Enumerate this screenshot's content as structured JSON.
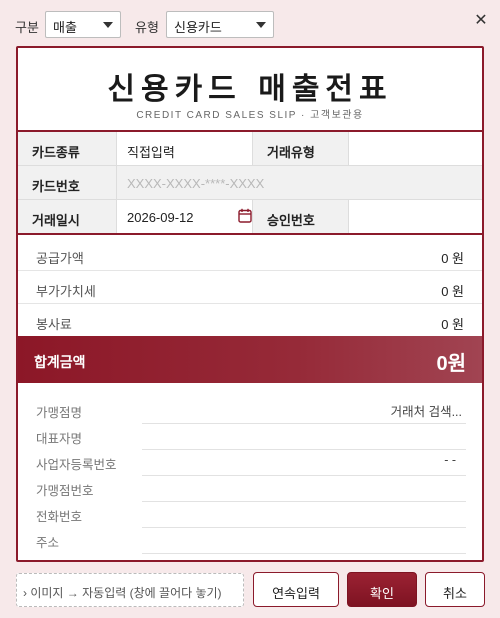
{
  "top": {
    "category_label": "구분",
    "category_value": "매출",
    "type_label": "유형",
    "type_value": "신용카드"
  },
  "slip": {
    "title": "신용카드 매출전표",
    "subtitle": "CREDIT CARD SALES SLIP · 고객보관용"
  },
  "info": {
    "card_type_label": "카드종류",
    "card_type_value": "직접입력",
    "trade_type_label": "거래유형",
    "trade_type_value": "",
    "card_no_label": "카드번호",
    "card_no_placeholder": "XXXX-XXXX-****-XXXX",
    "date_label": "거래일시",
    "date_value": "2026-09-12",
    "approval_label": "승인번호",
    "approval_value": ""
  },
  "amounts": {
    "supply_label": "공급가액",
    "supply_value": "0 원",
    "vat_label": "부가가치세",
    "vat_value": "0 원",
    "service_label": "봉사료",
    "service_value": "0 원",
    "total_label": "합계금액",
    "total_value": "0원"
  },
  "merchant": {
    "name_label": "가맹점명",
    "name_search": "거래처 검색...",
    "ceo_label": "대표자명",
    "bizno_label": "사업자등록번호",
    "bizno_value": "-  -",
    "merchant_no_label": "가맹점번호",
    "phone_label": "전화번호",
    "address_label": "주소"
  },
  "bottom": {
    "dropzone_text": "› 이미지 → 자동입력 (창에 끌어다 놓기)",
    "continuous_label": "연속입력",
    "confirm_label": "확인",
    "cancel_label": "취소"
  },
  "colors": {
    "accent": "#8b1a2b",
    "background": "#f7e9ea"
  }
}
